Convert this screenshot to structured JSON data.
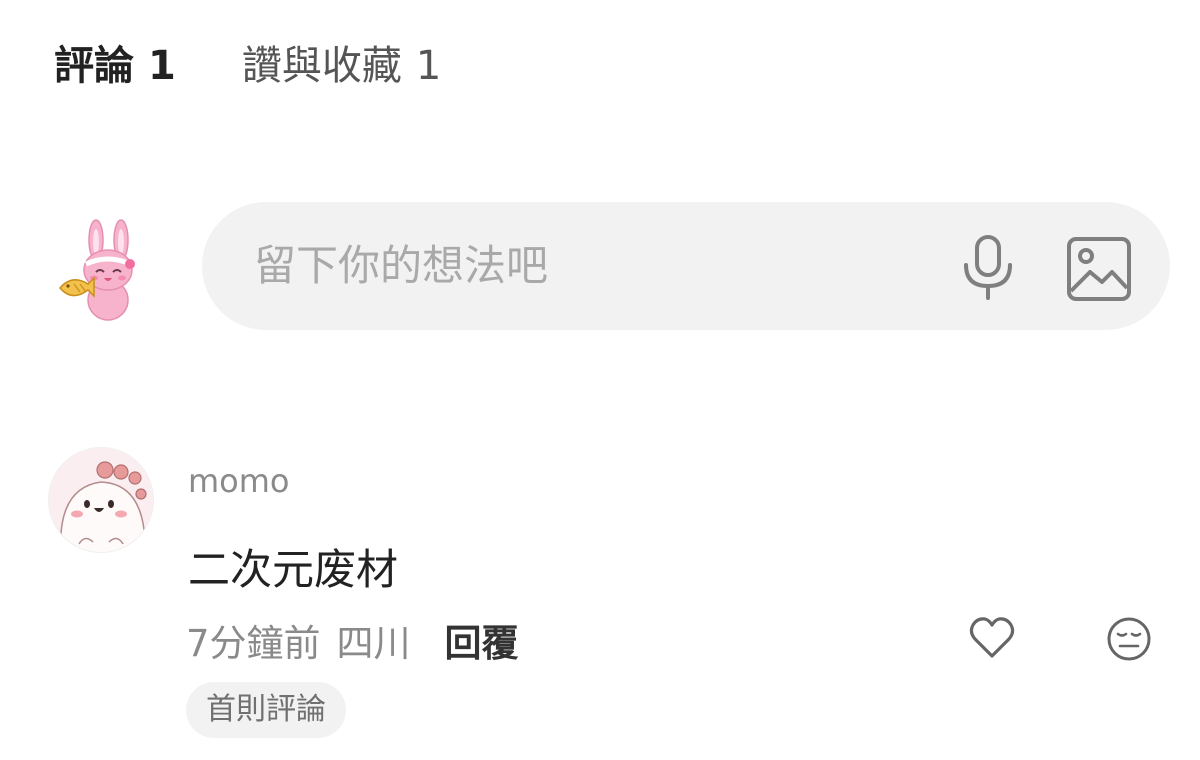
{
  "tabs": [
    {
      "label": "評論",
      "count": "1",
      "active": true
    },
    {
      "label": "讚與收藏",
      "count": "1",
      "active": false
    }
  ],
  "composer": {
    "placeholder": "留下你的想法吧",
    "mic_icon": "microphone-icon",
    "image_icon": "image-icon"
  },
  "comments": [
    {
      "username": "momo",
      "text": "二次元废材",
      "time": "7分鐘前",
      "location": "四川",
      "reply_label": "回覆",
      "badge": "首則評論",
      "like_icon": "heart-outline-icon",
      "emoji_icon": "meh-face-icon"
    }
  ],
  "colors": {
    "composer_bg": "#f2f2f2",
    "placeholder": "#a9a9a9",
    "meta_text": "#8a8a8a",
    "primary_text": "#222222",
    "avatar_pink": "#f6b6cf"
  }
}
